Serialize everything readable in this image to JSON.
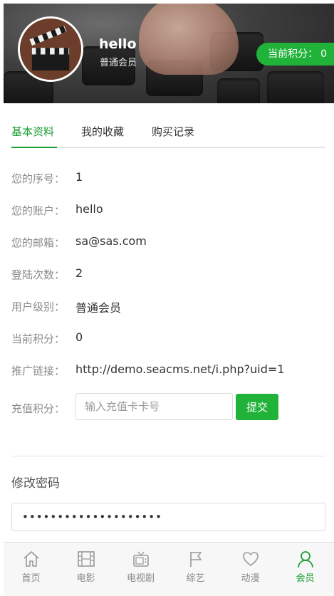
{
  "header": {
    "username": "hello",
    "level": "普通会员",
    "points_label": "当前积分：",
    "points_value": "0"
  },
  "tabs": [
    {
      "label": "基本资料",
      "active": true
    },
    {
      "label": "我的收藏",
      "active": false
    },
    {
      "label": "购买记录",
      "active": false
    }
  ],
  "profile": {
    "rows": [
      {
        "label": "您的序号：",
        "value": "1"
      },
      {
        "label": "您的账户：",
        "value": "hello"
      },
      {
        "label": "您的邮箱：",
        "value": "sa@sas.com"
      },
      {
        "label": "登陆次数：",
        "value": "2"
      },
      {
        "label": "用户级别：",
        "value": "普通会员"
      },
      {
        "label": "当前积分：",
        "value": "0"
      },
      {
        "label": "推广链接：",
        "value": "http://demo.seacms.net/i.php?uid=1"
      }
    ],
    "recharge_label": "充值积分：",
    "recharge_placeholder": "输入充值卡卡号",
    "submit_label": "提交"
  },
  "password": {
    "section_title": "修改密码",
    "value": "••••••••••••••••••••"
  },
  "bottom_nav": [
    {
      "label": "首页",
      "icon": "home-icon",
      "active": false
    },
    {
      "label": "电影",
      "icon": "film-icon",
      "active": false
    },
    {
      "label": "电视剧",
      "icon": "tv-icon",
      "active": false
    },
    {
      "label": "综艺",
      "icon": "flag-icon",
      "active": false
    },
    {
      "label": "动漫",
      "icon": "heart-icon",
      "active": false
    },
    {
      "label": "会员",
      "icon": "user-icon",
      "active": true
    }
  ],
  "colors": {
    "accent": "#21b23a",
    "accent_text": "#1b9e33",
    "label_gray": "#8a8a8a",
    "text": "#333333"
  }
}
